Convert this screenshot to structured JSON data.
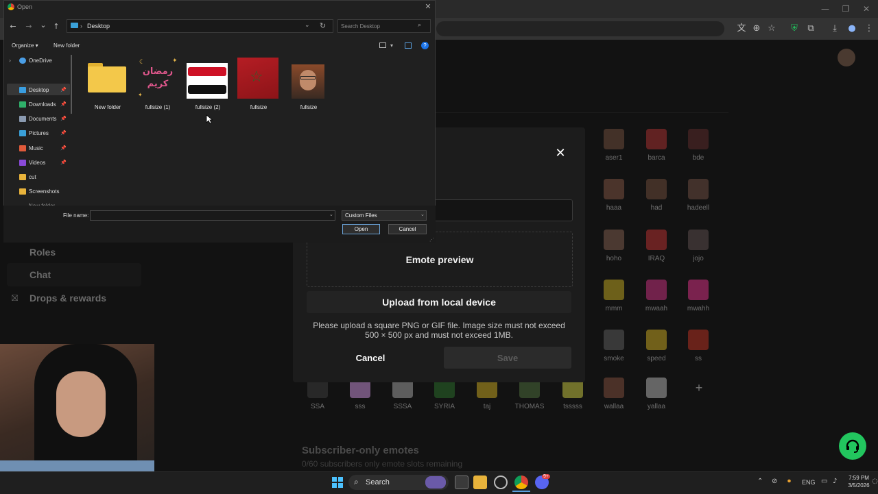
{
  "browser": {
    "window_controls": [
      "—",
      "❐",
      "✕"
    ],
    "toolbar_icons": [
      "translate-icon",
      "zoom-icon",
      "star-icon",
      "shield-icon",
      "extensions-icon",
      "download-icon",
      "profile-icon",
      "menu-icon"
    ]
  },
  "background_page": {
    "sidebar": [
      "Roles",
      "Chat",
      "Drops & rewards"
    ],
    "emotes": [
      "aser1",
      "barca",
      "bde",
      "haaa",
      "had",
      "hadeell",
      "hoho",
      "IRAQ",
      "jojo",
      "mmm",
      "mwaah",
      "mwahh",
      "smoke",
      "speed",
      "ss",
      "SSA",
      "sss",
      "SSSA",
      "SYRIA",
      "taj",
      "THOMAS",
      "tsssss",
      "wallaa",
      "yallaa"
    ],
    "add_emote_symbol": "+",
    "subscriber_title": "Subscriber-only emotes",
    "subscriber_subtitle": "0/60 subscribers only emote slots remaining"
  },
  "modal": {
    "close_symbol": "✕",
    "preview_label": "Emote preview",
    "upload_label": "Upload from local device",
    "hint": "Please upload a square PNG or GIF file. Image size must not exceed 500 × 500 px and must not exceed 1MB.",
    "cancel_label": "Cancel",
    "save_label": "Save"
  },
  "dialog": {
    "title": "Open",
    "close_symbol": "✕",
    "nav": {
      "back": "←",
      "forward": "→",
      "recent": "⌄",
      "up": "↑"
    },
    "path_chevron": "›",
    "path": "Desktop",
    "search_placeholder": "Search Desktop",
    "toolbar": {
      "organize": "Organize ▾",
      "new_folder": "New folder",
      "help": "?"
    },
    "nav_pane": {
      "onedrive": "OneDrive",
      "items": [
        "Desktop",
        "Downloads",
        "Documents",
        "Pictures",
        "Music",
        "Videos",
        "cut",
        "Screenshots"
      ],
      "cutoff_item": "New folder",
      "pin_symbol": "📌"
    },
    "files": [
      "New folder",
      "fullsize (1)",
      "fullsize (2)",
      "fullsize",
      "fullsize"
    ],
    "ramadan_text": "رمضان كريم",
    "file_name_label": "File name:",
    "file_name_value": "",
    "file_type": "Custom Files",
    "open_label": "Open",
    "cancel_label": "Cancel"
  },
  "taskbar": {
    "search_label": "Search",
    "language": "ENG",
    "time": "7:59 PM",
    "date": "3/5/2026",
    "discord_badge": "9+"
  },
  "colors": {
    "kick_green": "#22c55e",
    "accent_blue": "#1a73e8"
  }
}
